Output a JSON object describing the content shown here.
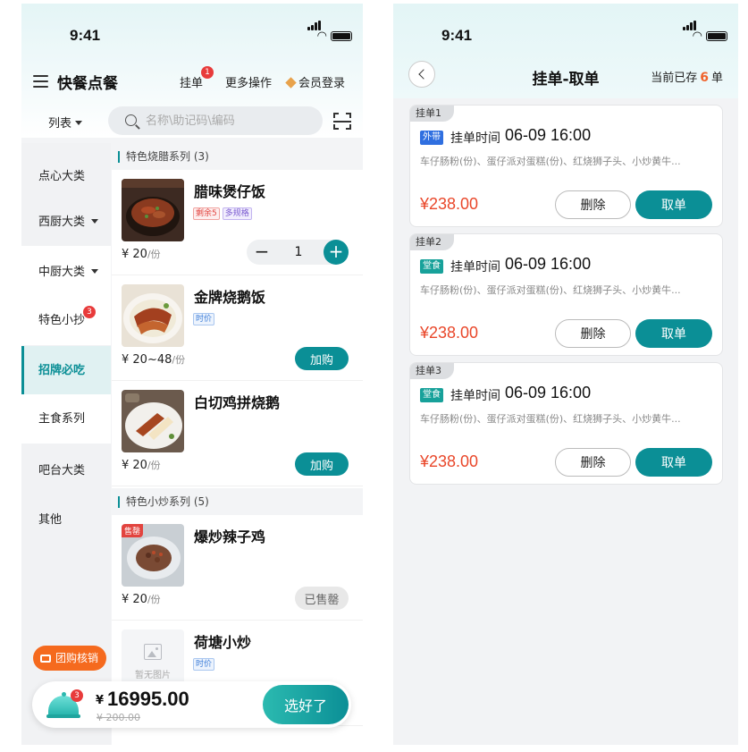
{
  "status_time": "9:41",
  "left": {
    "header": {
      "title": "快餐点餐",
      "hold_label": "挂单",
      "hold_badge": "1",
      "more_label": "更多操作",
      "member_label": "会员登录"
    },
    "view_toggle": "列表",
    "search": {
      "placeholder": "名称\\助记码\\编码"
    },
    "categories": [
      {
        "label": "点心大类"
      },
      {
        "label": "西厨大类",
        "dropdown": true
      },
      {
        "label": "中厨大类",
        "dropdown": true
      },
      {
        "label": "特色小抄",
        "badge": "3"
      },
      {
        "label": "招牌必吃",
        "active": true
      },
      {
        "label": "主食系列"
      },
      {
        "label": "吧台大类"
      },
      {
        "label": "其他"
      }
    ],
    "sections": [
      {
        "title": "特色烧腊系列 (3)"
      },
      {
        "title": "特色小炒系列 (5)"
      }
    ],
    "items": [
      {
        "name": "腊味煲仔饭",
        "tags": [
          "剩余5",
          "多规格"
        ],
        "price": "¥ 20",
        "unit": "/份",
        "qty": "1"
      },
      {
        "name": "金牌烧鹅饭",
        "tags": [
          "时价"
        ],
        "price": "¥ 20~48",
        "unit": "/份",
        "action": "加购"
      },
      {
        "name": "白切鸡拼烧鹅",
        "price": "¥ 20",
        "unit": "/份",
        "action": "加购"
      },
      {
        "name": "爆炒辣子鸡",
        "sold_tag": "售罄",
        "price": "¥ 20",
        "unit": "/份",
        "action": "已售罄"
      },
      {
        "name": "荷塘小炒",
        "tags": [
          "时价"
        ],
        "no_image": "暂无图片"
      }
    ],
    "group_buy": "团购核销",
    "cart": {
      "badge": "3",
      "currency": "¥",
      "total": "16995.00",
      "original": "¥ 200.00",
      "checkout": "选好了"
    }
  },
  "right": {
    "title": "挂单-取单",
    "saved_prefix": "当前已存",
    "saved_count": "6",
    "saved_suffix": "单",
    "orders": [
      {
        "tag": "挂单1",
        "type": "外带",
        "type_color": "#2f6fe0",
        "time_label": "挂单时间",
        "time": "06-09 16:00",
        "desc": "车仔肠粉(份)、蛋仔派对蛋糕(份)、红烧狮子头、小炒黄牛...",
        "price": "¥238.00",
        "delete": "删除",
        "take": "取单"
      },
      {
        "tag": "挂单2",
        "type": "堂食",
        "type_color": "#17a19a",
        "time_label": "挂单时间",
        "time": "06-09 16:00",
        "desc": "车仔肠粉(份)、蛋仔派对蛋糕(份)、红烧狮子头、小炒黄牛...",
        "price": "¥238.00",
        "delete": "删除",
        "take": "取单"
      },
      {
        "tag": "挂单3",
        "type": "堂食",
        "type_color": "#17a19a",
        "time_label": "挂单时间",
        "time": "06-09 16:00",
        "desc": "车仔肠粉(份)、蛋仔派对蛋糕(份)、红烧狮子头、小炒黄牛...",
        "price": "¥238.00",
        "delete": "删除",
        "take": "取单"
      }
    ]
  },
  "colors": {
    "accent": "#0b8f96",
    "price": "#e9472a",
    "badge": "#e83b3b",
    "group_buy": "#f56a1e"
  }
}
